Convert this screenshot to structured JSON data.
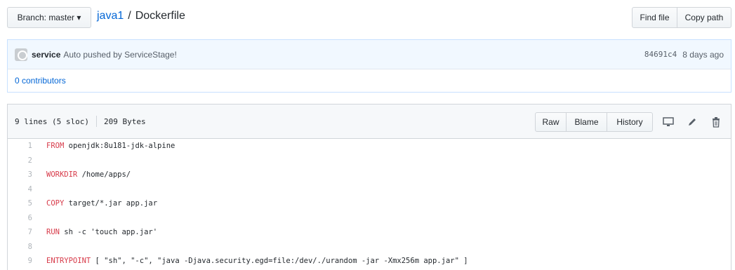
{
  "branch_button": {
    "label": "Branch: master ▾"
  },
  "breadcrumb": {
    "repo": "java1",
    "separator": "/",
    "file": "Dockerfile"
  },
  "toolbar": {
    "find_file": "Find file",
    "copy_path": "Copy path"
  },
  "commit": {
    "author": "service",
    "message": "Auto pushed by ServiceStage!",
    "sha": "84691c4",
    "time": "8 days ago",
    "avatar_icon": "avatar-icon"
  },
  "contributors": {
    "label": "0 contributors"
  },
  "file_info": {
    "lines": "9 lines (5 sloc)",
    "size": "209 Bytes"
  },
  "file_actions": {
    "raw": "Raw",
    "blame": "Blame",
    "history": "History",
    "icons": [
      "desktop-icon",
      "pencil-icon",
      "trash-icon"
    ]
  },
  "code": [
    {
      "n": "1",
      "kw": "FROM",
      "rest": " openjdk:8u181-jdk-alpine"
    },
    {
      "n": "2",
      "kw": "",
      "rest": ""
    },
    {
      "n": "3",
      "kw": "WORKDIR",
      "rest": " /home/apps/"
    },
    {
      "n": "4",
      "kw": "",
      "rest": ""
    },
    {
      "n": "5",
      "kw": "COPY",
      "rest": " target/*.jar app.jar"
    },
    {
      "n": "6",
      "kw": "",
      "rest": ""
    },
    {
      "n": "7",
      "kw": "RUN",
      "rest": " sh -c 'touch app.jar'"
    },
    {
      "n": "8",
      "kw": "",
      "rest": ""
    },
    {
      "n": "9",
      "kw": "ENTRYPOINT",
      "rest": " [ \"sh\", \"-c\", \"java -Djava.security.egd=file:/dev/./urandom -jar -Xmx256m app.jar\" ]"
    }
  ],
  "colors": {
    "link": "#0366d6",
    "keyword": "#d73a49",
    "commit_bg": "#f1f8ff"
  }
}
